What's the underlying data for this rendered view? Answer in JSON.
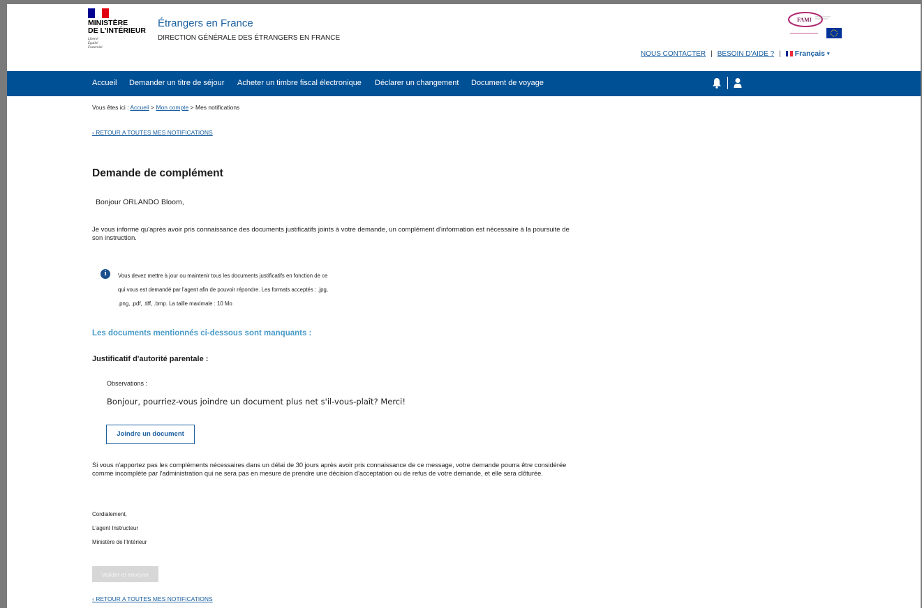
{
  "header": {
    "ministry_line1": "MINISTÈRE",
    "ministry_line2": "DE L'INTÉRIEUR",
    "devise_1": "Liberté",
    "devise_2": "Égalité",
    "devise_3": "Fraternité",
    "site_title": "Étrangers en France",
    "site_subtitle": "DIRECTION GÉNÉRALE DES ÉTRANGERS EN FRANCE",
    "fami_label": "FAMI",
    "links": {
      "contact": "NOUS CONTACTER",
      "separator": "|",
      "help": "BESOIN D'AIDE ?",
      "language": "Français"
    }
  },
  "nav": {
    "items": [
      "Accueil",
      "Demander un titre de séjour",
      "Acheter un timbre fiscal électronique",
      "Déclarer un changement",
      "Document de voyage"
    ],
    "icons": [
      "bell-icon",
      "user-icon"
    ]
  },
  "breadcrumb": {
    "prefix": "Vous êtes ici :",
    "home": "Accueil",
    "sep1": ">",
    "account": "Mon compte",
    "sep2": ">",
    "current": "Mes notifications"
  },
  "back_link": "‹ RETOUR A TOUTES MES NOTIFICATIONS",
  "page_title": "Demande de complément",
  "greeting": "Bonjour ORLANDO Bloom,",
  "intro": "Je vous informe qu'après avoir pris connaissance des documents justificatifs joints à votre demande, un complément d'information est nécessaire à la poursuite de son instruction.",
  "info": {
    "line1": "Vous devez mettre à jour ou maintenir tous les documents justificatifs en fonction de ce",
    "line2": "qui vous est demandé par l'agent afin de pouvoir répondre. Les formats acceptés : .jpg,",
    "line3": ".png, .pdf, .tiff, .bmp. La taille maximale : 10 Mo"
  },
  "missing_heading": "Les documents mentionnés ci-dessous sont manquants :",
  "document": {
    "title": "Justificatif d'autorité parentale :",
    "observations_label": "Observations :",
    "observations_text": "Bonjour, pourriez-vous joindre un document plus net s'il-vous-plaît? Merci!",
    "attach_button": "Joindre un document"
  },
  "warning": "Si vous n'apportez pas les compléments nécessaires dans un délai de 30 jours après avoir pris connaissance de ce message, votre demande pourra être considérée comme incomplète par l'administration qui ne sera pas en mesure de prendre une décision d'acceptation ou de refus de votre demande, et elle sera clôturée.",
  "closing": {
    "line1": "Cordialement,",
    "line2": "L'agent Instructeur",
    "line3": "Ministère de l'Intérieur"
  },
  "submit_button": "Valider et envoyer",
  "colors": {
    "nav_bg": "#005096",
    "link": "#1a5fa0",
    "heading_blue": "#4a9bc9",
    "info_icon": "#1a4f8c",
    "disabled_button": "#d7d7d7"
  }
}
